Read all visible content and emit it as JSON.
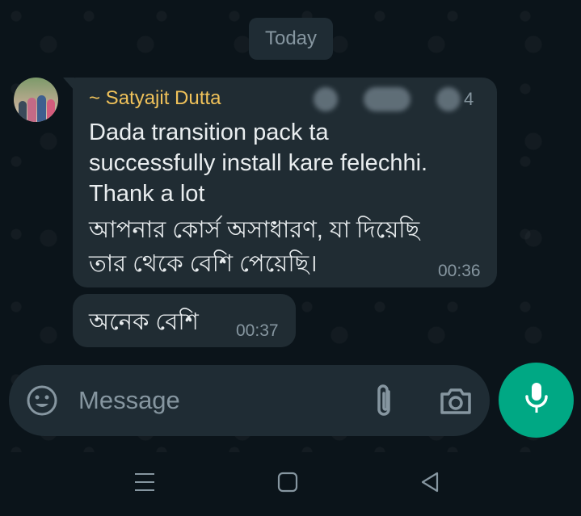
{
  "chat": {
    "date_chip": "Today",
    "messages": [
      {
        "sender": "~ Satyajit Dutta",
        "masked_suffix": "4",
        "lines": [
          "Dada transition pack ta",
          "successfully install kare felechhi.",
          "Thank a lot",
          "আপনার কোর্স অসাধারণ, যা দিয়েছি",
          "তার থেকে বেশি পেয়েছি।"
        ],
        "time": "00:36"
      },
      {
        "lines": [
          "অনেক বেশি"
        ],
        "time": "00:37"
      }
    ]
  },
  "composer": {
    "placeholder": "Message",
    "icons": [
      "emoji-icon",
      "attach-icon",
      "camera-icon",
      "mic-icon"
    ]
  },
  "navbar": {
    "icons": [
      "recents-icon",
      "home-icon",
      "back-icon"
    ]
  },
  "colors": {
    "background": "#0b141a",
    "bubble": "#202c33",
    "sender_name": "#f0c25a",
    "accent": "#00a884",
    "muted": "#8696a0"
  }
}
